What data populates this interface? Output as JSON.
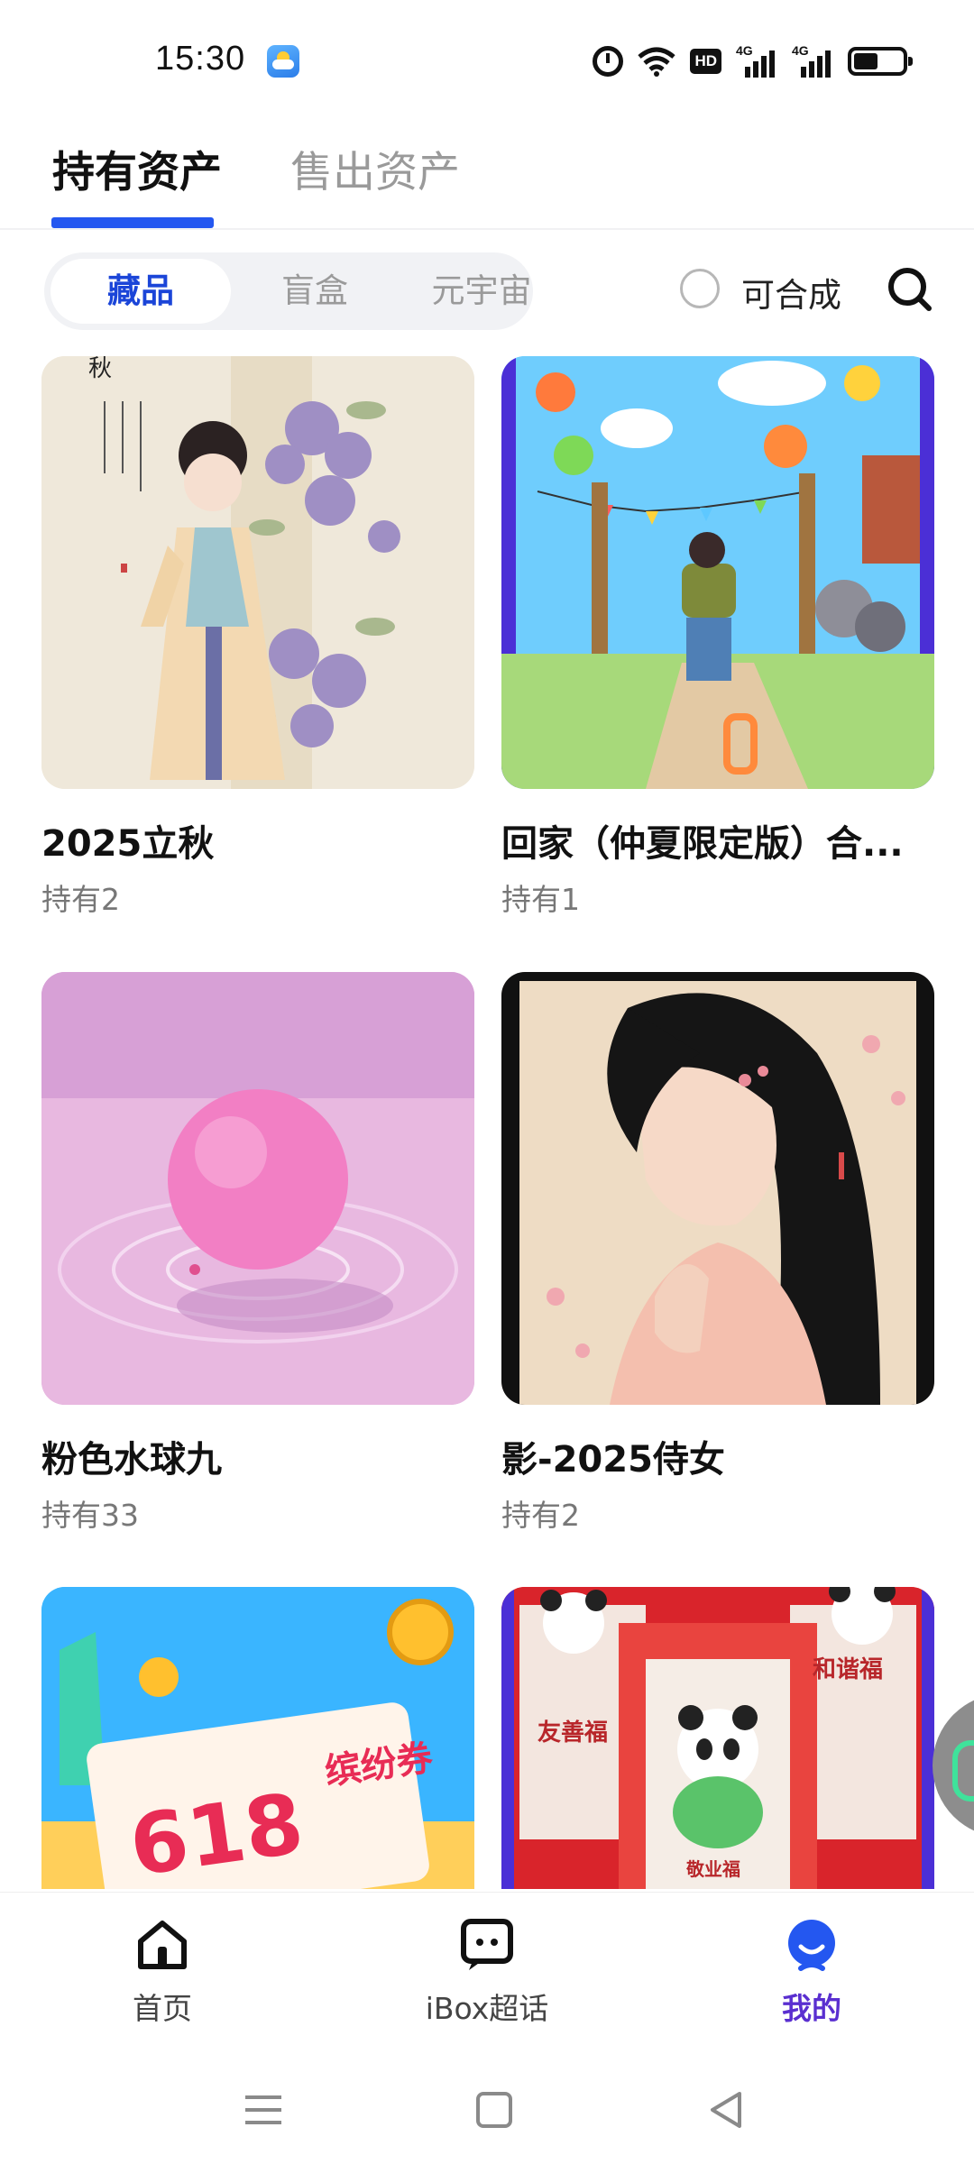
{
  "status_bar": {
    "time": "15:30",
    "icons": [
      "weather-app-icon",
      "alarm-icon",
      "wifi-icon",
      "hd-voice-icon",
      "signal-4g-icon",
      "signal-4g-icon",
      "battery-icon"
    ],
    "hd_label": "HD",
    "network_label": "4G"
  },
  "main_tabs": [
    {
      "label": "持有资产",
      "active": true
    },
    {
      "label": "售出资产",
      "active": false
    }
  ],
  "filter": {
    "segments": [
      {
        "label": "藏品",
        "active": true
      },
      {
        "label": "盲盒",
        "active": false
      },
      {
        "label": "元宇宙",
        "active": false
      }
    ],
    "combinable_label": "可合成",
    "combinable_checked": false
  },
  "items": [
    {
      "title": "2025立秋",
      "count": "持有2",
      "art_text": "秋"
    },
    {
      "title": "回家（仲夏限定版）合...",
      "count": "持有1"
    },
    {
      "title": "粉色水球九",
      "count": "持有33"
    },
    {
      "title": "影-2025侍女",
      "count": "持有2"
    },
    {
      "title": "",
      "count": "",
      "art_text": "618",
      "art_text2": "缤纷券"
    },
    {
      "title": "",
      "count": "",
      "art_text": "友善福",
      "art_text2": "和谐福",
      "art_text3": "敬业福"
    }
  ],
  "bottom_nav": [
    {
      "label": "首页",
      "icon": "home-icon",
      "active": false
    },
    {
      "label": "iBox超话",
      "icon": "chat-icon",
      "active": false
    },
    {
      "label": "我的",
      "icon": "profile-icon",
      "active": true
    }
  ],
  "colors": {
    "accent": "#2457f0",
    "segment_active_text": "#1b45d8",
    "nav_active": "#5a2fd0"
  }
}
